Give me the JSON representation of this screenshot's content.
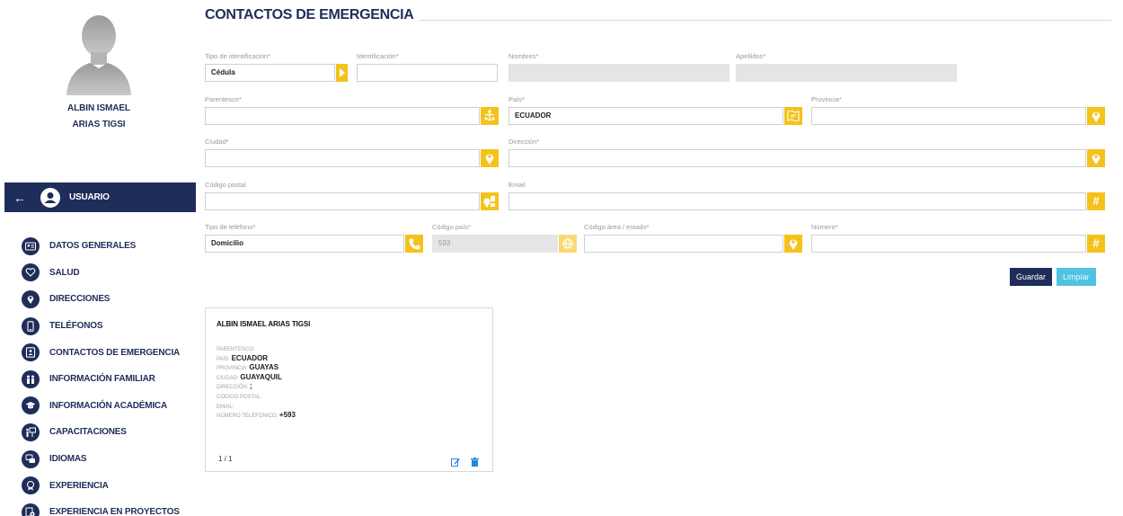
{
  "user": {
    "first_line": "ALBIN ISMAEL",
    "second_line": "ARIAS TIGSI",
    "bar_label": "USUARIO"
  },
  "menu": [
    {
      "label": "DATOS GENERALES",
      "icon": "id-card-icon"
    },
    {
      "label": "SALUD",
      "icon": "heart-hand-icon"
    },
    {
      "label": "DIRECCIONES",
      "icon": "map-pin-icon"
    },
    {
      "label": "TELÉFONOS",
      "icon": "phone-icon"
    },
    {
      "label": "CONTACTOS DE EMERGENCIA",
      "icon": "contact-book-icon"
    },
    {
      "label": "INFORMACIÓN FAMILIAR",
      "icon": "family-icon"
    },
    {
      "label": "INFORMACIÓN ACADÉMICA",
      "icon": "graduation-cap-icon"
    },
    {
      "label": "CAPACITACIONES",
      "icon": "training-board-icon"
    },
    {
      "label": "IDIOMAS",
      "icon": "language-chat-icon"
    },
    {
      "label": "EXPERIENCIA",
      "icon": "badge-icon"
    },
    {
      "label": "EXPERIENCIA EN PROYECTOS",
      "icon": "project-gear-icon"
    }
  ],
  "page": {
    "title": "CONTACTOS DE EMERGENCIA"
  },
  "form": {
    "tipo_id": {
      "label": "Tipo de identificación*",
      "value": "Cédula"
    },
    "identificacion": {
      "label": "Identificación*",
      "value": ""
    },
    "nombres": {
      "label": "Nombres*",
      "value": ""
    },
    "apellidos": {
      "label": "Apellidos*",
      "value": ""
    },
    "parentesco": {
      "label": "Parentesco*",
      "value": ""
    },
    "pais": {
      "label": "País*",
      "value": "ECUADOR"
    },
    "provincia": {
      "label": "Provincia*",
      "value": ""
    },
    "ciudad": {
      "label": "Ciudad*",
      "value": ""
    },
    "direccion": {
      "label": "Dirección*",
      "value": ""
    },
    "codigo_postal": {
      "label": "Código postal",
      "value": ""
    },
    "email": {
      "label": "Email",
      "value": ""
    },
    "tipo_telefono": {
      "label": "Tipo de teléfono*",
      "value": "Domicilio"
    },
    "codigo_pais": {
      "label": "Código país*",
      "value": "593"
    },
    "codigo_area": {
      "label": "Código área / estado*",
      "value": ""
    },
    "numero": {
      "label": "Número*",
      "value": ""
    },
    "save_label": "Guardar",
    "clear_label": "Limpiar",
    "hash_symbol": "#"
  },
  "card": {
    "name": "ALBIN ISMAEL ARIAS TIGSI",
    "rows": [
      {
        "key": "PARENTESCO:",
        "value": ""
      },
      {
        "key": "PAÍS:",
        "value": "ECUADOR"
      },
      {
        "key": "PROVINCIA:",
        "value": "GUAYAS"
      },
      {
        "key": "CIUDAD:",
        "value": "GUAYAQUIL"
      },
      {
        "key": "DIRECCIÓN:",
        "value": ";"
      },
      {
        "key": "CÓDIGO POSTAL:",
        "value": ""
      },
      {
        "key": "EMAIL:",
        "value": ""
      },
      {
        "key": "NÚMERO TELÉFONICO:",
        "value": "+593"
      }
    ],
    "pager": "1 / 1"
  },
  "colors": {
    "navy": "#1f2d5a",
    "accent_yellow": "#f5c21b",
    "clear_button": "#4fc3e0",
    "edit_icon": "#1e88e5"
  }
}
